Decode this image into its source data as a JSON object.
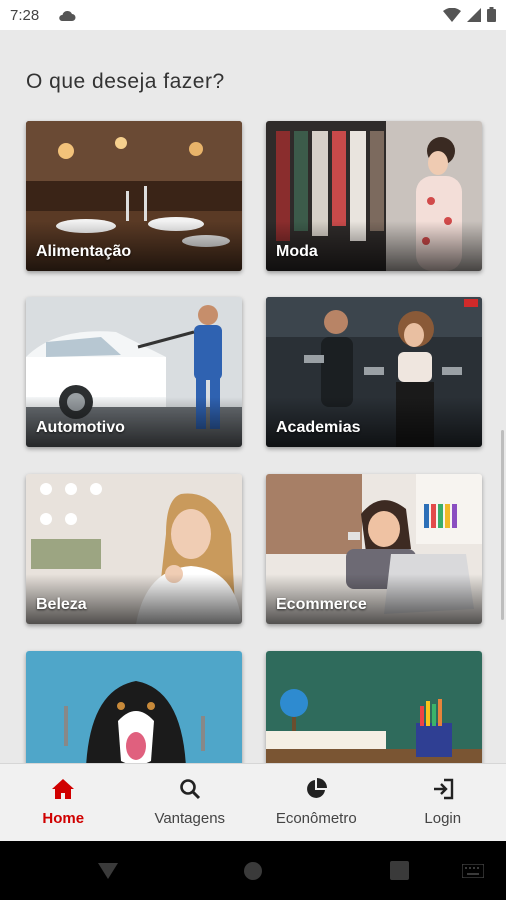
{
  "status_bar": {
    "time": "7:28"
  },
  "heading": "O que deseja fazer?",
  "categories": [
    {
      "label": "Alimentação"
    },
    {
      "label": "Moda"
    },
    {
      "label": "Automotivo"
    },
    {
      "label": "Academias"
    },
    {
      "label": "Beleza"
    },
    {
      "label": "Ecommerce"
    },
    {
      "label": ""
    },
    {
      "label": ""
    }
  ],
  "bottom_nav": {
    "items": [
      {
        "label": "Home",
        "icon": "home-icon",
        "active": true
      },
      {
        "label": "Vantagens",
        "icon": "search-icon",
        "active": false
      },
      {
        "label": "Econômetro",
        "icon": "pie-chart-icon",
        "active": false
      },
      {
        "label": "Login",
        "icon": "login-icon",
        "active": false
      }
    ]
  },
  "colors": {
    "accent": "#d00000",
    "background": "#e9e9e9"
  }
}
